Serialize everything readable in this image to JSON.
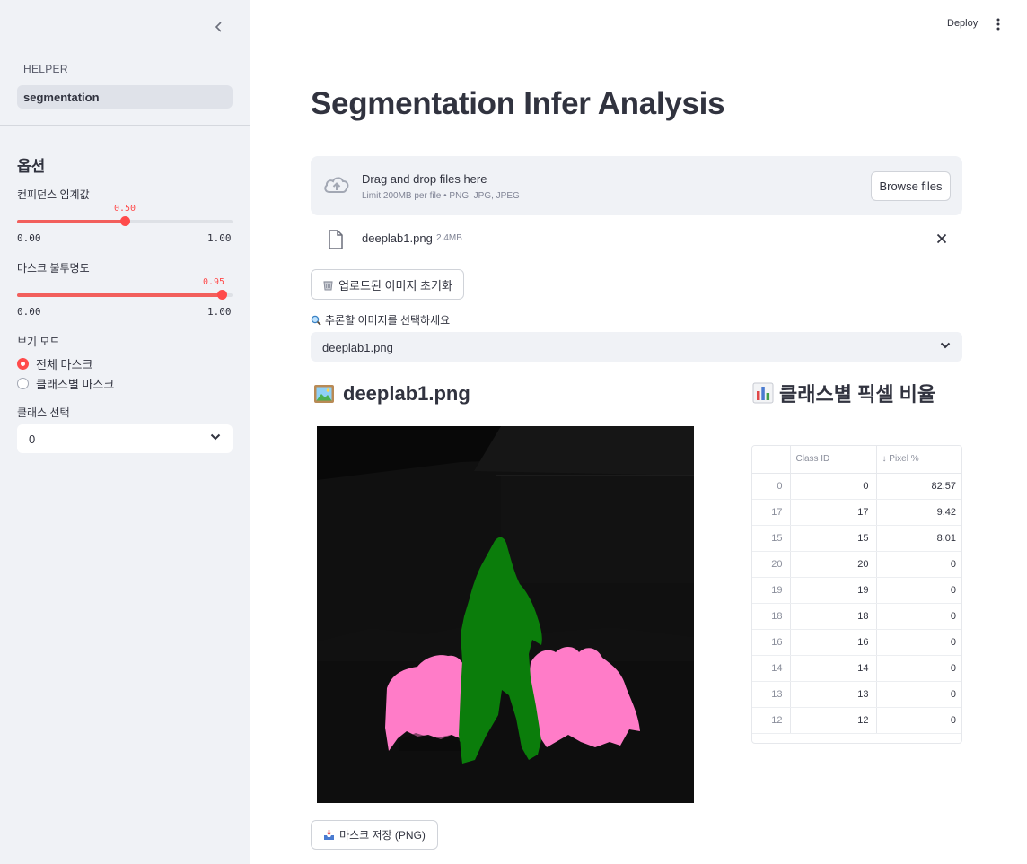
{
  "sidebar": {
    "nav_heading": "HELPER",
    "nav_items": [
      {
        "label": "segmentation",
        "active": true
      }
    ],
    "options_title": "옵션",
    "confidence": {
      "label": "컨피던스 임계값",
      "value": "0.50",
      "min": "0.00",
      "max": "1.00",
      "fraction": 0.5
    },
    "opacity": {
      "label": "마스크 불투명도",
      "value": "0.95",
      "min": "0.00",
      "max": "1.00",
      "fraction": 0.95
    },
    "view_mode": {
      "label": "보기 모드",
      "options": [
        "전체 마스크",
        "클래스별 마스크"
      ],
      "selected": 0
    },
    "class_select": {
      "label": "클래스 선택",
      "value": "0"
    }
  },
  "header": {
    "deploy_label": "Deploy",
    "menu_icon": "more-vertical-icon"
  },
  "main": {
    "title": "Segmentation Infer Analysis",
    "uploader": {
      "drop_text": "Drag and drop files here",
      "limit_text": "Limit 200MB per file • PNG, JPG, JPEG",
      "browse_label": "Browse files"
    },
    "uploaded_file": {
      "name": "deeplab1.png",
      "size": "2.4MB"
    },
    "reset_button": "업로드된 이미지 초기화",
    "choose_label": "추론할 이미지를 선택하세요",
    "choose_value": "deeplab1.png",
    "image_heading": "deeplab1.png",
    "save_button": "마스크 저장 (PNG)",
    "table_heading": "클래스별 픽셀 비율",
    "table": {
      "columns": [
        "",
        "Class ID",
        "↓ Pixel %"
      ],
      "rows": [
        [
          "0",
          "0",
          "82.57"
        ],
        [
          "17",
          "17",
          "9.42"
        ],
        [
          "15",
          "15",
          "8.01"
        ],
        [
          "20",
          "20",
          "0"
        ],
        [
          "19",
          "19",
          "0"
        ],
        [
          "18",
          "18",
          "0"
        ],
        [
          "16",
          "16",
          "0"
        ],
        [
          "14",
          "14",
          "0"
        ],
        [
          "13",
          "13",
          "0"
        ],
        [
          "12",
          "12",
          "0"
        ]
      ]
    }
  },
  "colors": {
    "accent": "#ff4b4b",
    "sidebar_bg": "#f0f2f6",
    "person_mask": "#0b7d0b",
    "sheep_mask": "#ff7cc8"
  }
}
